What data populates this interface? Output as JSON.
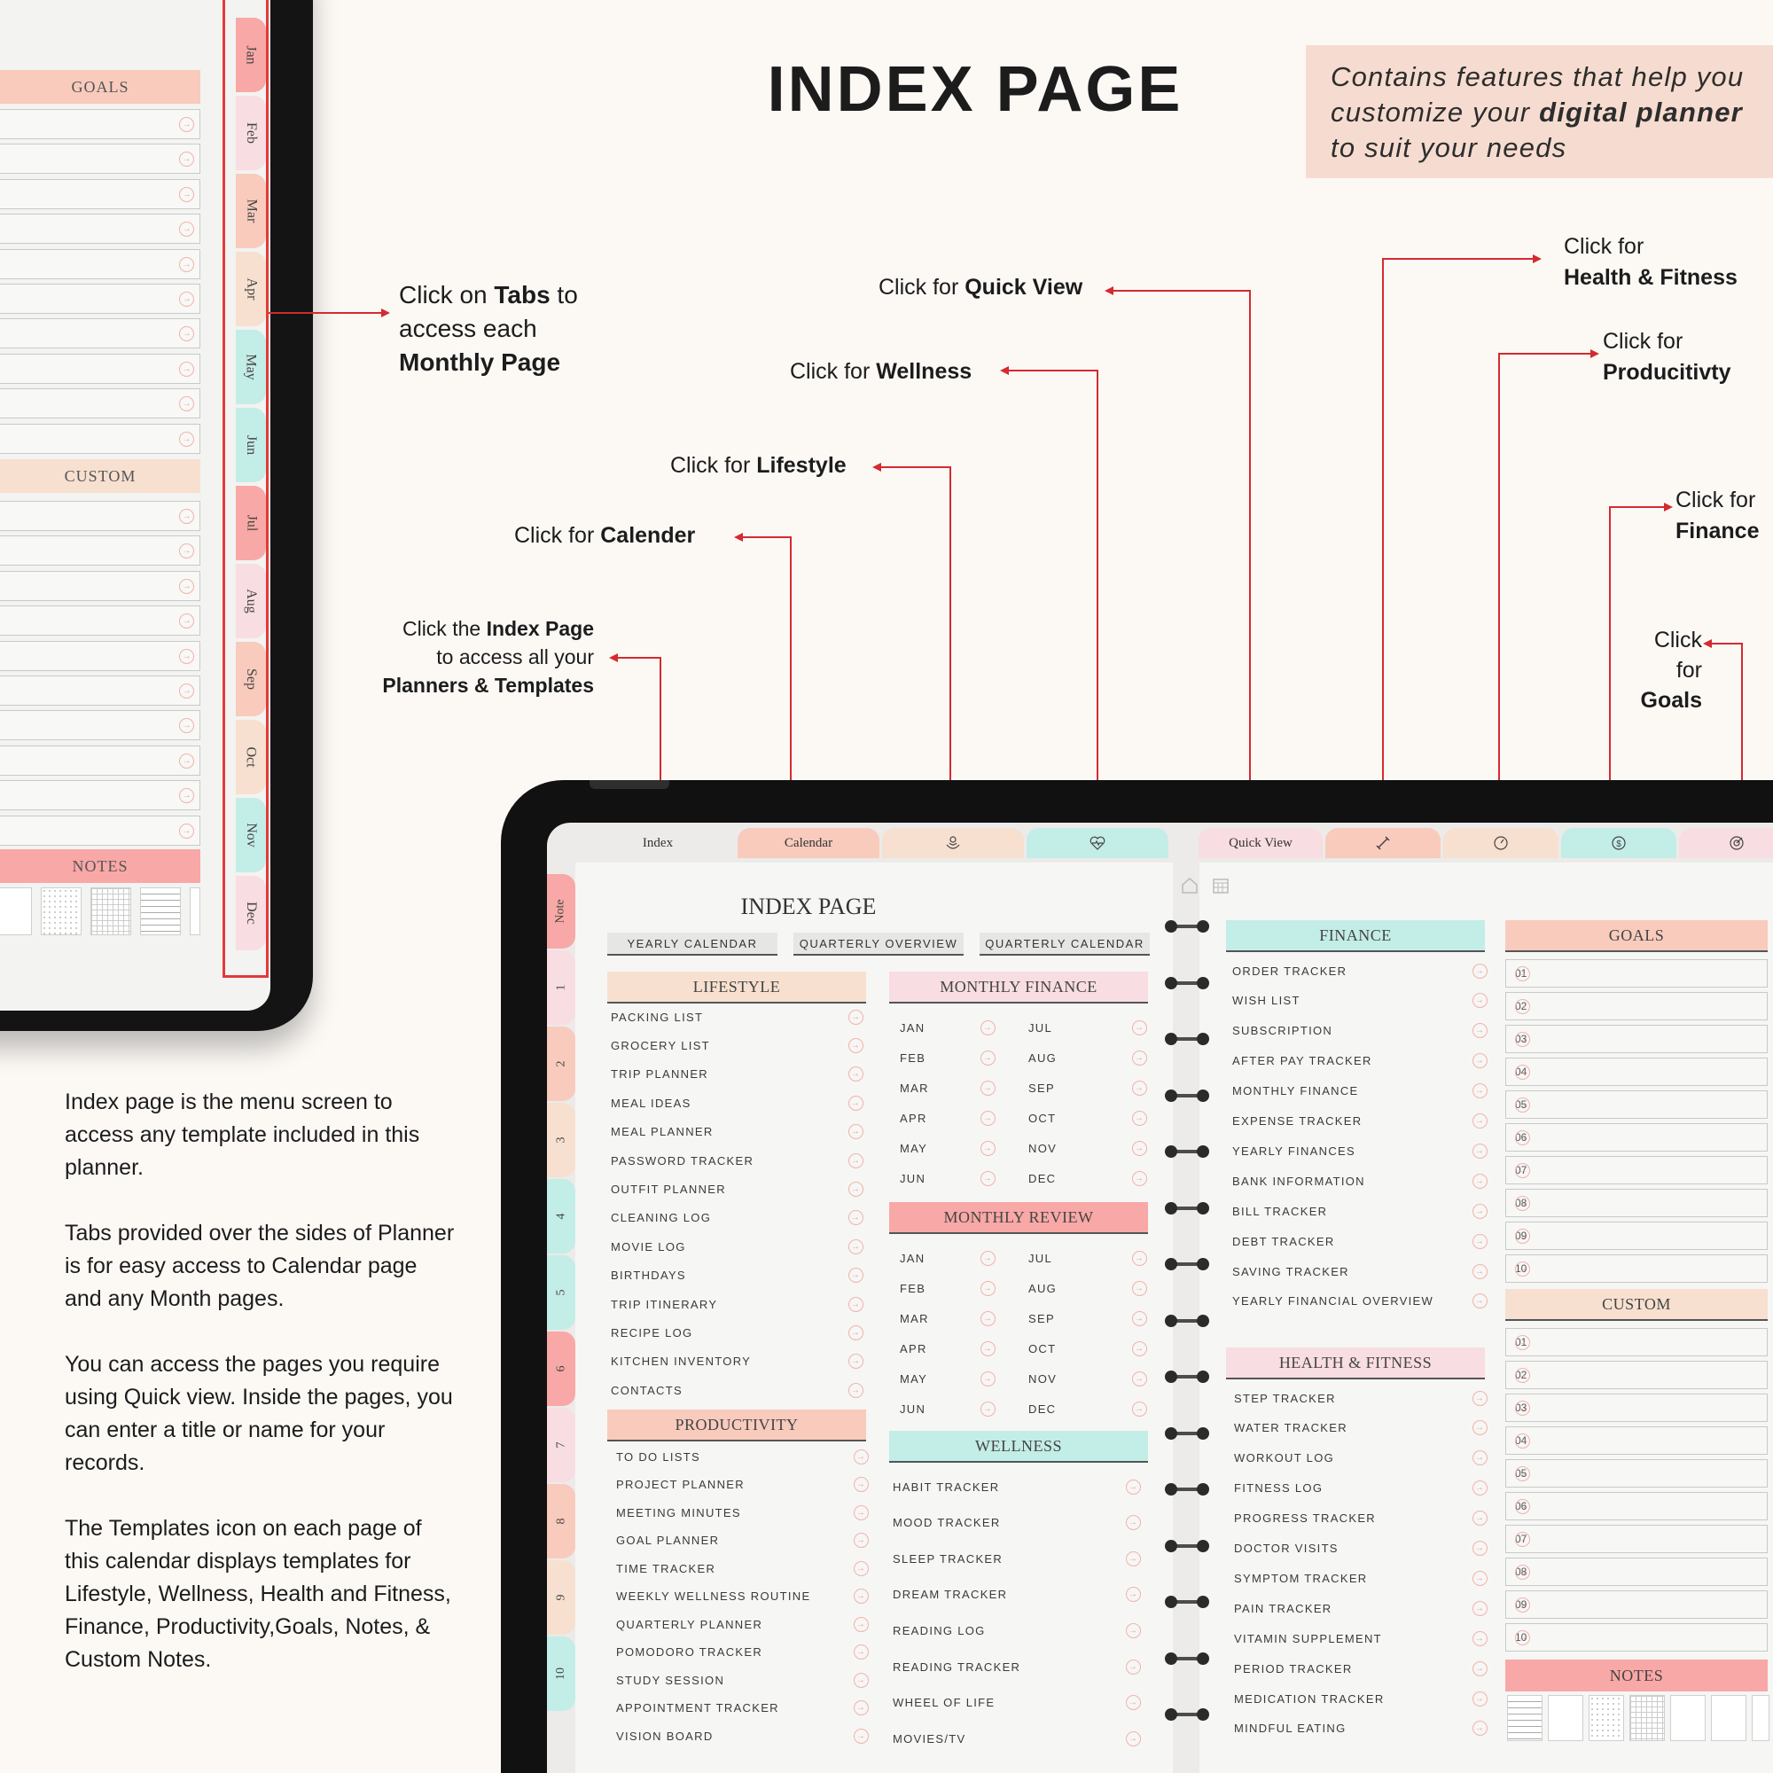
{
  "title": "INDEX PAGE",
  "title_note": {
    "line1": "Contains features that help you",
    "line2_pre": "customize your ",
    "line2_bold": "digital planner",
    "line3": "to suit your needs"
  },
  "callouts": {
    "tabs": {
      "pre": "Click on ",
      "bold1": "Tabs",
      "mid": " to",
      "line2": "access each",
      "bold2": "Monthly Page"
    },
    "quick_view": {
      "pre": "Click for ",
      "bold": "Quick View"
    },
    "wellness": {
      "pre": "Click for ",
      "bold": "Wellness"
    },
    "lifestyle": {
      "pre": "Click for ",
      "bold": "Lifestyle"
    },
    "calender": {
      "pre": "Click for ",
      "bold": "Calender"
    },
    "index": {
      "pre": "Click the ",
      "bold": "Index Page",
      "line2": "to access all your",
      "bold2": "Planners & Templates"
    },
    "health": {
      "line1": "Click for",
      "bold": "Health & Fitness"
    },
    "productivity": {
      "line1": "Click for",
      "bold": "Producitivty"
    },
    "finance": {
      "line1": "Click for",
      "bold": "Finance"
    },
    "goals": {
      "line1": "Click",
      "line2": "for",
      "bold": "Goals"
    }
  },
  "description": [
    "Index page is the menu screen to access any template included in this planner.",
    "Tabs provided over the sides of Planner is for easy access to Calendar page and any Month pages.",
    "You can access the pages you require using Quick view. Inside the pages, you can enter a title or name for your records.",
    "The Templates icon on each page of this calendar displays templates for Lifestyle, Wellness, Health and Fitness, Finance, Productivity,Goals, Notes, & Custom Notes."
  ],
  "tl_device": {
    "goals_label": "GOALS",
    "custom_label": "CUSTOM",
    "notes_label": "NOTES",
    "months": [
      "Jan",
      "Feb",
      "Mar",
      "Apr",
      "May",
      "Jun",
      "Jul",
      "Aug",
      "Sep",
      "Oct",
      "Nov",
      "Dec"
    ]
  },
  "br_device": {
    "top_tabs": {
      "index": "Index",
      "calendar": "Calendar",
      "quick_view": "Quick View"
    },
    "side_tabs": [
      "Note",
      "1",
      "2",
      "3",
      "4",
      "5",
      "6",
      "7",
      "8",
      "9",
      "10"
    ],
    "page_title": "INDEX PAGE",
    "pills": [
      "YEARLY CALENDAR",
      "QUARTERLY OVERVIEW",
      "QUARTERLY CALENDAR"
    ],
    "lifestyle": {
      "title": "LIFESTYLE",
      "items": [
        "PACKING LIST",
        "GROCERY LIST",
        "TRIP PLANNER",
        "MEAL IDEAS",
        "MEAL PLANNER",
        "PASSWORD TRACKER",
        "OUTFIT PLANNER",
        "CLEANING LOG",
        "MOVIE LOG",
        "BIRTHDAYS",
        "TRIP ITINERARY",
        "RECIPE LOG",
        "KITCHEN INVENTORY",
        "CONTACTS"
      ]
    },
    "productivity": {
      "title": "PRODUCTIVITY",
      "items": [
        "TO DO LISTS",
        "PROJECT PLANNER",
        "MEETING MINUTES",
        "GOAL PLANNER",
        "TIME TRACKER",
        "WEEKLY WELLNESS ROUTINE",
        "QUARTERLY PLANNER",
        "POMODORO TRACKER",
        "STUDY SESSION",
        "APPOINTMENT TRACKER",
        "VISION BOARD"
      ]
    },
    "monthly_finance": {
      "title": "MONTHLY FINANCE",
      "left": [
        "JAN",
        "FEB",
        "MAR",
        "APR",
        "MAY",
        "JUN"
      ],
      "right": [
        "JUL",
        "AUG",
        "SEP",
        "OCT",
        "NOV",
        "DEC"
      ]
    },
    "monthly_review": {
      "title": "MONTHLY REVIEW",
      "left": [
        "JAN",
        "FEB",
        "MAR",
        "APR",
        "MAY",
        "JUN"
      ],
      "right": [
        "JUL",
        "AUG",
        "SEP",
        "OCT",
        "NOV",
        "DEC"
      ]
    },
    "wellness": {
      "title": "WELLNESS",
      "items": [
        "HABIT TRACKER",
        "MOOD TRACKER",
        "SLEEP TRACKER",
        "DREAM TRACKER",
        "READING LOG",
        "READING TRACKER",
        "WHEEL OF LIFE",
        "MOVIES/TV"
      ]
    },
    "finance": {
      "title": "FINANCE",
      "items": [
        "ORDER TRACKER",
        "WISH LIST",
        "SUBSCRIPTION",
        "AFTER PAY TRACKER",
        "MONTHLY FINANCE",
        "EXPENSE TRACKER",
        "YEARLY FINANCES",
        "BANK INFORMATION",
        "BILL TRACKER",
        "DEBT TRACKER",
        "SAVING TRACKER",
        "YEARLY FINANCIAL OVERVIEW"
      ]
    },
    "health": {
      "title": "HEALTH & FITNESS",
      "items": [
        "STEP TRACKER",
        "WATER TRACKER",
        "WORKOUT LOG",
        "FITNESS LOG",
        "PROGRESS TRACKER",
        "DOCTOR VISITS",
        "SYMPTOM TRACKER",
        "PAIN  TRACKER",
        "VITAMIN SUPPLEMENT",
        "PERIOD TRACKER",
        "MEDICATION TRACKER",
        "MINDFUL EATING"
      ]
    },
    "goals": {
      "title": "GOALS",
      "numbers": [
        "01",
        "02",
        "03",
        "04",
        "05",
        "06",
        "07",
        "08",
        "09",
        "10"
      ]
    },
    "custom": {
      "title": "CUSTOM",
      "numbers": [
        "01",
        "02",
        "03",
        "04",
        "05",
        "06",
        "07",
        "08",
        "09",
        "10"
      ]
    },
    "notes": {
      "title": "NOTES"
    }
  },
  "colors": {
    "accent_red": "#d42a31",
    "peach": "#f7e0cf",
    "pink": "#f8dde2",
    "coral": "#f8a8a6",
    "mint": "#c3ede7",
    "salmon": "#f8cbbd"
  },
  "icons": [
    "home-icon",
    "calendar-grid-icon",
    "lotus-icon",
    "heart-pulse-icon",
    "dumbbell-icon",
    "gauge-icon",
    "dollar-coin-icon",
    "target-icon",
    "arrow-right-circle-icon"
  ]
}
